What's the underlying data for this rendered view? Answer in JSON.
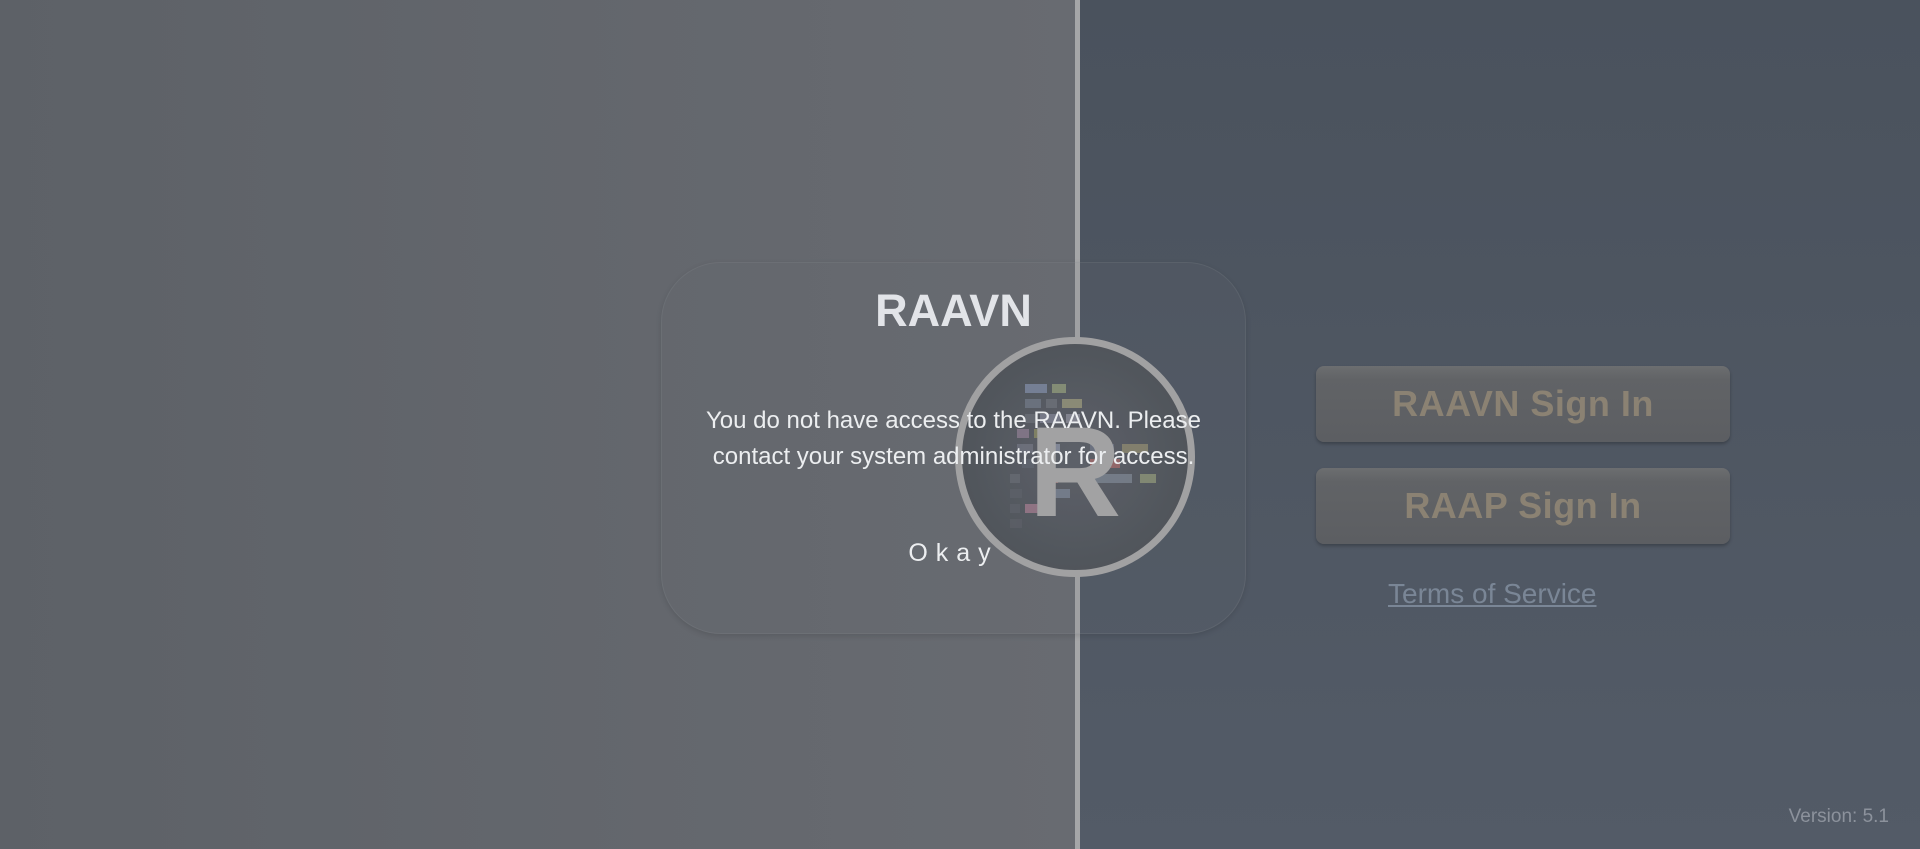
{
  "modal": {
    "title": "RAAVN",
    "message": "You do not have access to the RAAVN. Please contact your system administrator for access.",
    "okay_label": "Okay"
  },
  "auth": {
    "raavn_signin_label": "RAAVN Sign In",
    "raap_signin_label": "RAAP Sign In",
    "terms_label": "Terms of Service"
  },
  "logo": {
    "letter": "R",
    "icon": "raavn-logo-icon"
  },
  "footer": {
    "version": "Version: 5.1"
  },
  "colors": {
    "left_panel": "#64676d",
    "right_panel": "#4f5762",
    "divider": "#a5a6a8",
    "button_text": "#8b8273",
    "link": "#7a8696"
  }
}
